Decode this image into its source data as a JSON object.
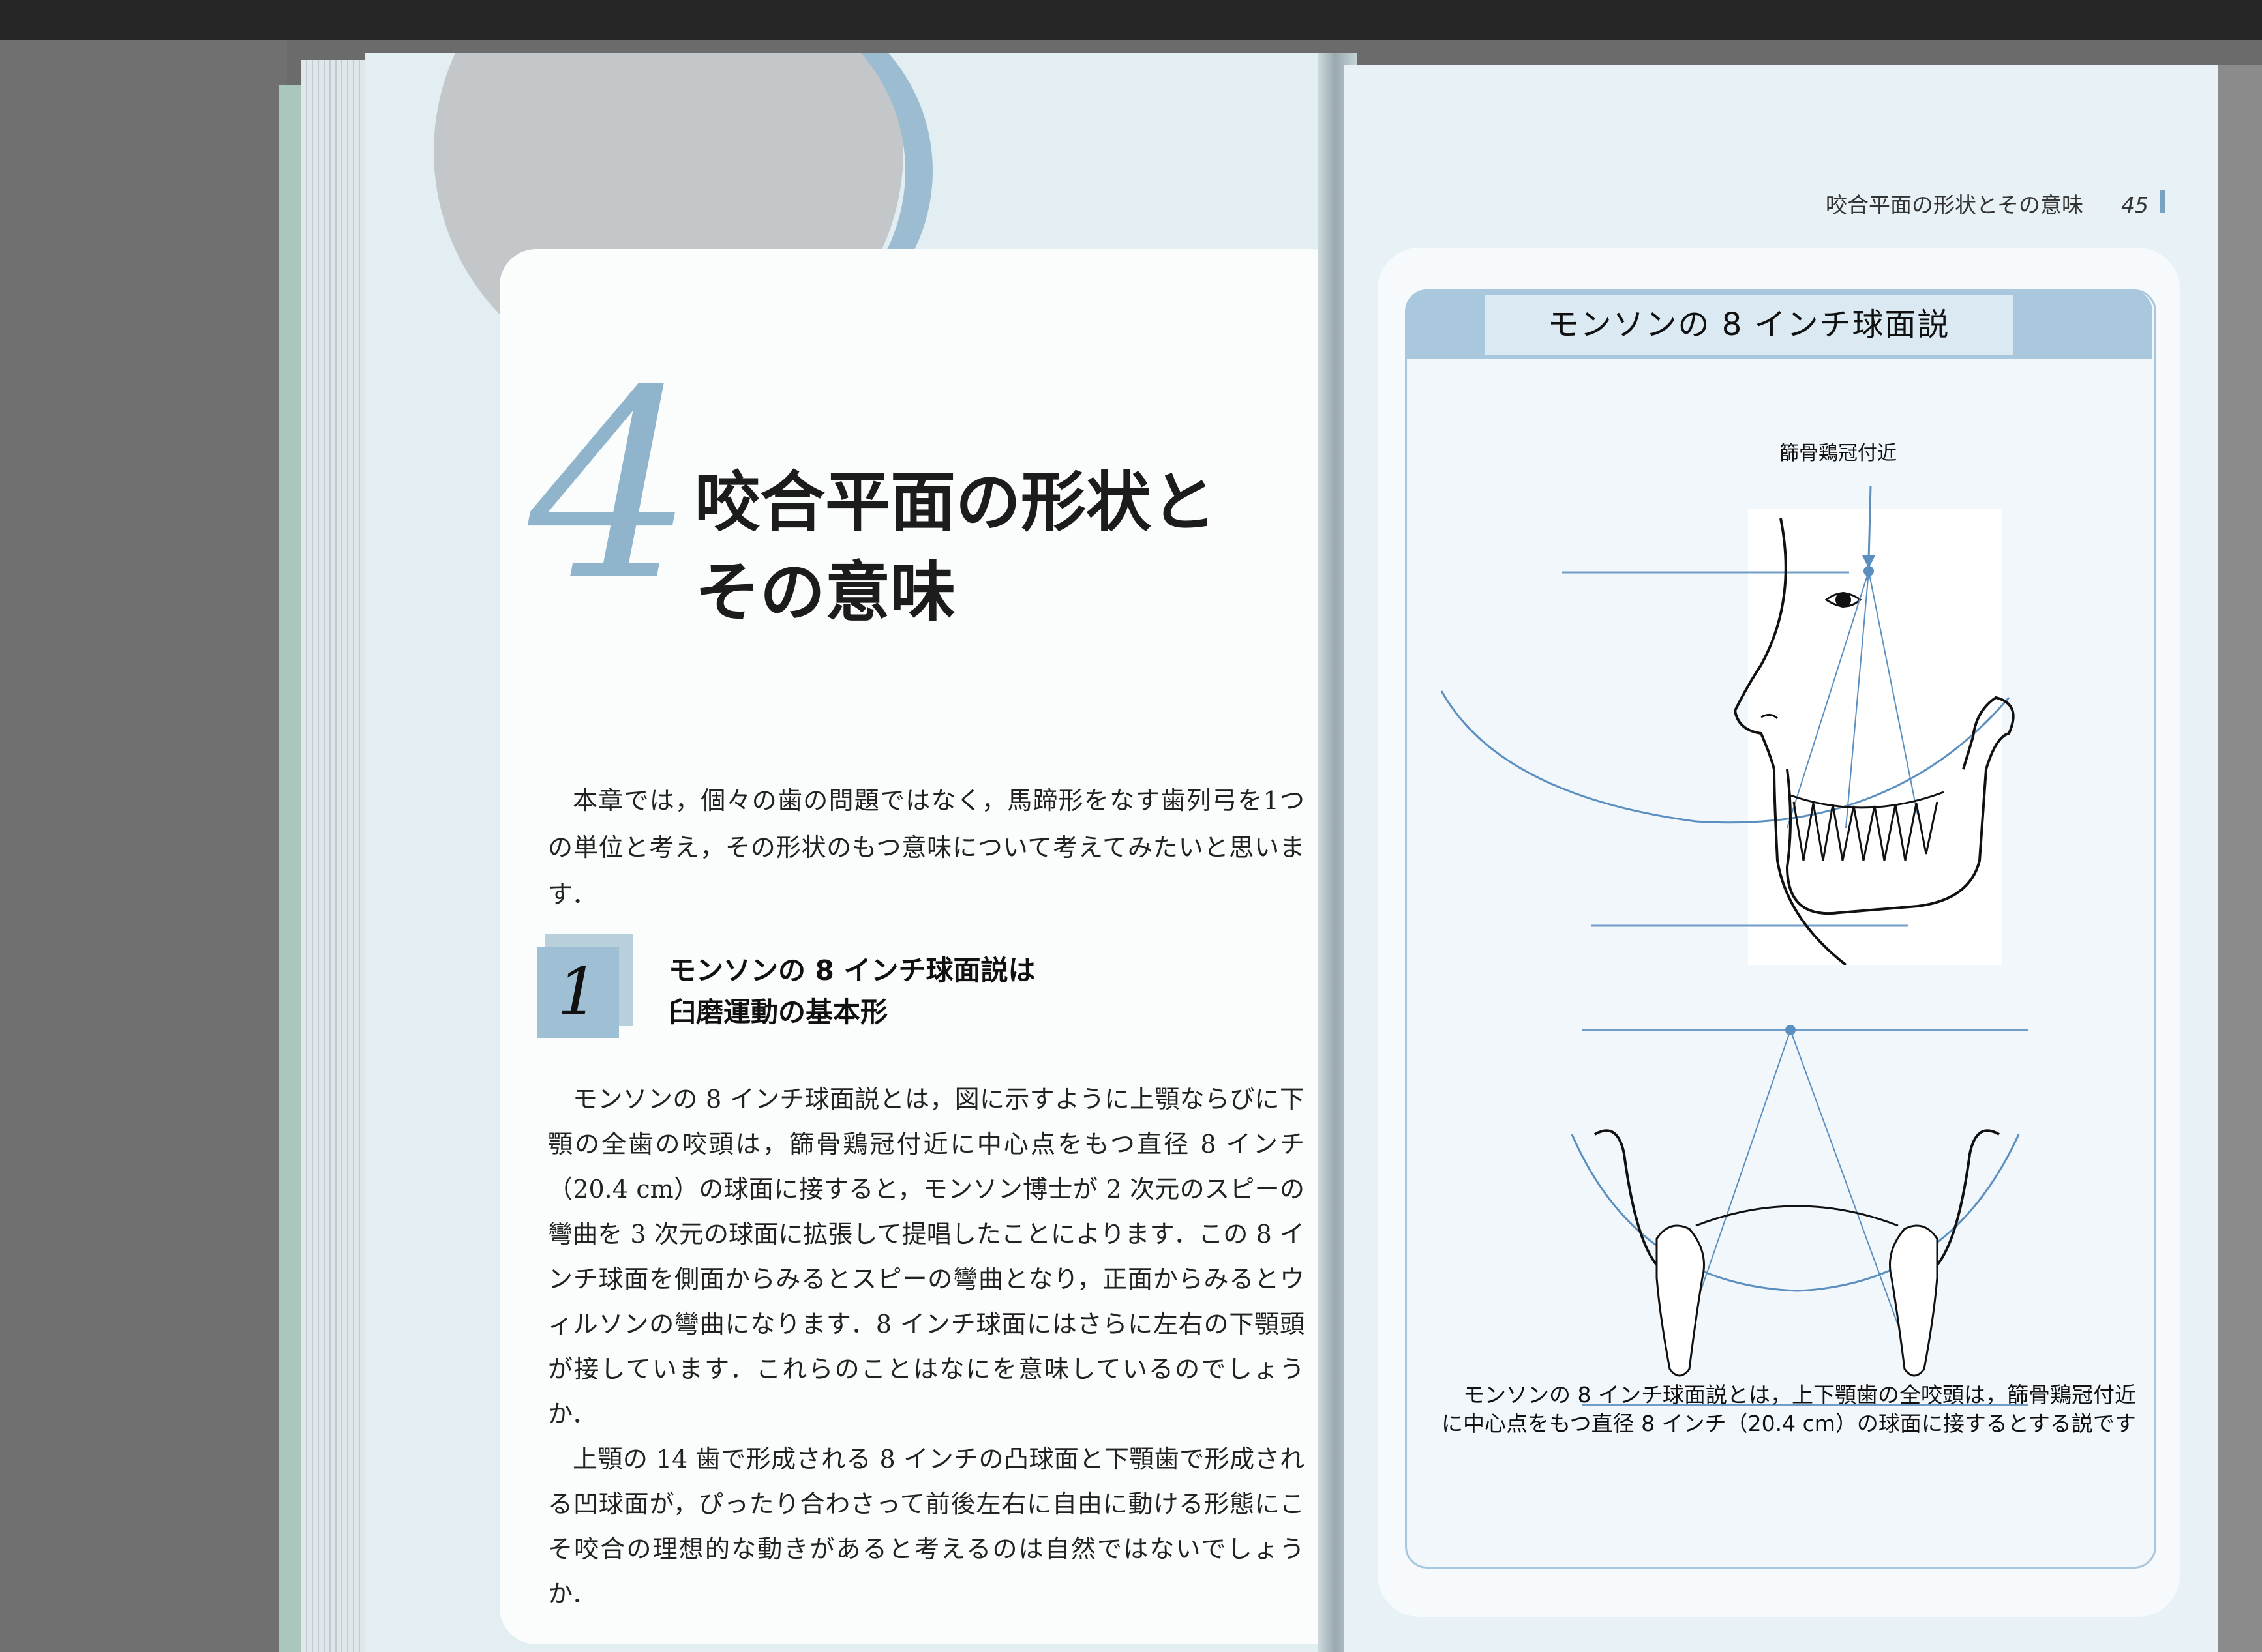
{
  "left_page": {
    "chapter_number": "4",
    "chapter_title_lines": [
      "咬合平面の形状と",
      "その意味"
    ],
    "intro": "本章では，個々の歯の問題ではなく，馬蹄形をなす歯列弓を1つの単位と考え，その形状のもつ意味について考えてみたいと思います．",
    "section": {
      "number": "1",
      "title_lines": [
        "モンソンの 8 インチ球面説は",
        "臼磨運動の基本形"
      ]
    },
    "paragraphs": [
      "モンソンの 8 インチ球面説とは，図に示すように上顎ならびに下顎の全歯の咬頭は，篩骨鶏冠付近に中心点をもつ直径 8 インチ（20.4 cm）の球面に接すると，モンソン博士が 2 次元のスピーの彎曲を 3 次元の球面に拡張して提唱したことによります．この 8 インチ球面を側面からみるとスピーの彎曲となり，正面からみるとウィルソンの彎曲になります．8 インチ球面にはさらに左右の下顎頭が接しています．これらのことはなにを意味しているのでしょうか．",
      "上顎の 14 歯で形成される 8 インチの凸球面と下顎歯で形成される凹球面が，ぴったり合わさって前後左右に自由に動ける形態にこそ咬合の理想的な動きがあると考えるのは自然ではないでしょうか．"
    ]
  },
  "right_page": {
    "running_head": "咬合平面の形状とその意味",
    "page_number": "45",
    "box_title": "モンソンの 8 インチ球面説",
    "figure_label": "篩骨鶏冠付近",
    "caption": "モンソンの 8 インチ球面説とは，上下顎歯の全咬頭は，篩骨鶏冠付近に中心点をもつ直径 8 インチ（20.4 cm）の球面に接するとする説です"
  },
  "colors": {
    "accent_blue": "#9fc0d4",
    "page_tint": "#e3eef2",
    "line_blue": "#5b8fc0"
  }
}
